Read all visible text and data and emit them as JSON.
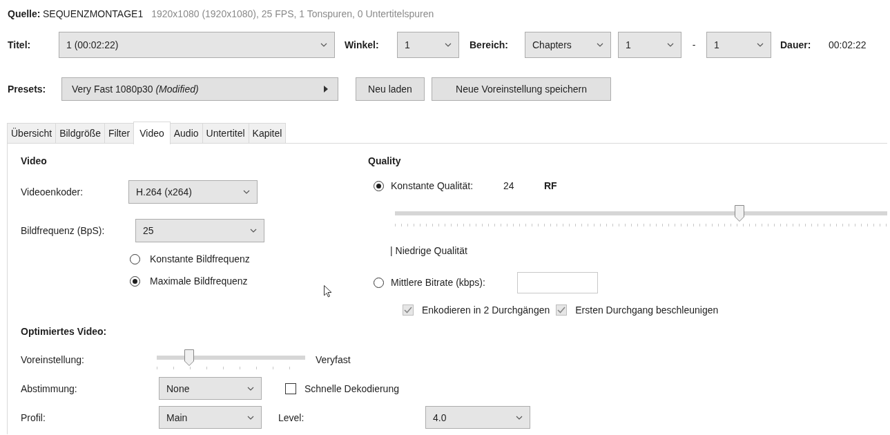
{
  "source": {
    "label": "Quelle:",
    "name": "SEQUENZMONTAGE1",
    "details": "1920x1080 (1920x1080), 25 FPS, 1 Tonspuren, 0 Untertitelspuren"
  },
  "title_row": {
    "title": {
      "label": "Titel:",
      "value": "1 (00:02:22)"
    },
    "angle": {
      "label": "Winkel:",
      "value": "1"
    },
    "range": {
      "label": "Bereich:",
      "mode": "Chapters",
      "start": "1",
      "separator": "-",
      "end": "1"
    },
    "duration": {
      "label": "Dauer:",
      "value": "00:02:22"
    }
  },
  "presets": {
    "label": "Presets:",
    "value": "Very Fast 1080p30 *(Modified)*",
    "buttons": [
      "Neu laden",
      "Neue Voreinstellung speichern"
    ]
  },
  "tabs": [
    {
      "label": "Übersicht",
      "selected": false
    },
    {
      "label": "Bildgröße",
      "selected": false
    },
    {
      "label": "Filter",
      "selected": false
    },
    {
      "label": "Video",
      "selected": true
    },
    {
      "label": "Audio",
      "selected": false
    },
    {
      "label": "Untertitel",
      "selected": false
    },
    {
      "label": "Kapitel",
      "selected": false
    }
  ],
  "video": {
    "heading": "Video",
    "encoder": {
      "label": "Videoenkoder:",
      "value": "H.264 (x264)"
    },
    "framerate": {
      "label": "Bildfrequenz (BpS):",
      "value": "25"
    },
    "framerate_modes": [
      {
        "label": "Konstante Bildfrequenz",
        "selected": false
      },
      {
        "label": "Maximale Bildfrequenz",
        "selected": true
      }
    ]
  },
  "quality": {
    "heading": "Quality",
    "constant": {
      "label": "Konstante Qualität:",
      "value": "24",
      "unit": "RF",
      "selected": true,
      "level": 0.7
    },
    "scale_label": "| Niedrige Qualität",
    "bitrate": {
      "label": "Mittlere Bitrate (kbps):",
      "selected": false
    },
    "options": [
      {
        "label": "Enkodieren in 2 Durchgängen",
        "checked": true,
        "disabled": true
      },
      {
        "label": "Ersten Durchgang beschleunigen",
        "checked": true,
        "disabled": true
      }
    ]
  },
  "optimised": {
    "heading": "Optimiertes Video:",
    "preset": {
      "label": "Voreinstellung:",
      "level": 0.22,
      "value": "Veryfast"
    },
    "tune": {
      "label": "Abstimmung:",
      "value": "None"
    },
    "fast_decode": {
      "label": "Schnelle Dekodierung",
      "checked": false,
      "disabled": false
    },
    "profile": {
      "label": "Profil:",
      "value": "Main"
    },
    "level": {
      "label": "Level:",
      "value": "4.0"
    }
  }
}
